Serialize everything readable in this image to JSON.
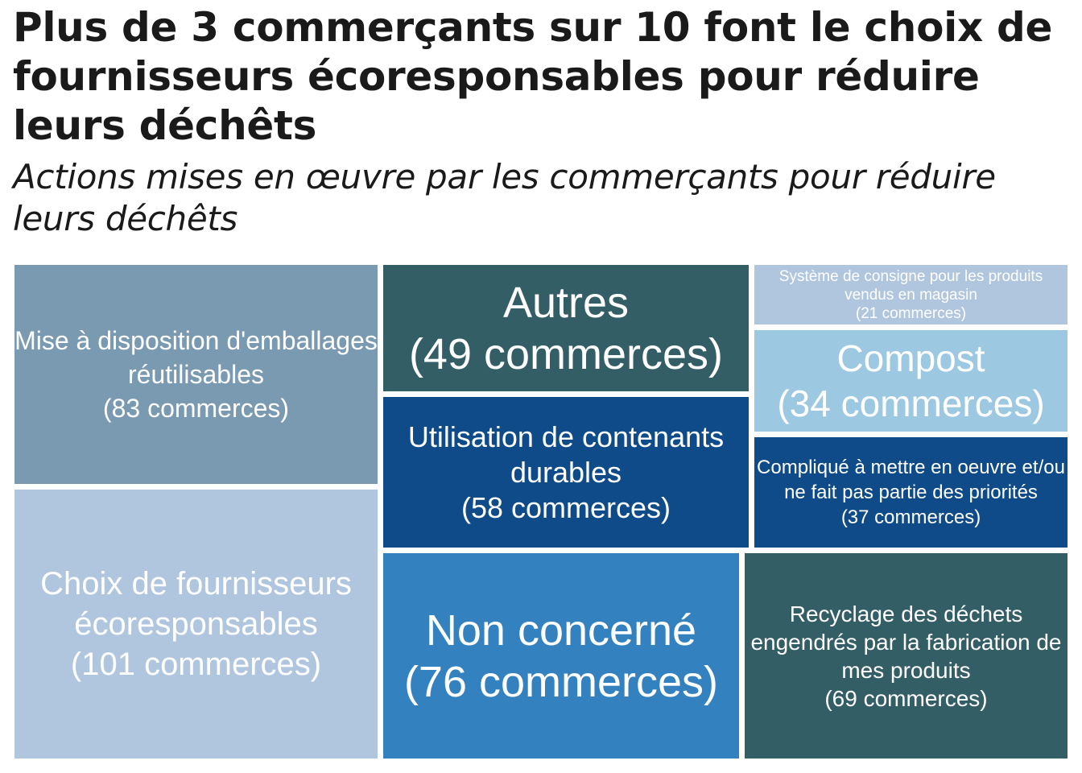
{
  "title": "Plus de 3 commerçants sur 10 font le choix de fournisseurs écoresponsables pour réduire leurs déchêts",
  "subtitle": "Actions mises en œuvre par les commerçants pour réduire leurs déchêts",
  "chart_data": {
    "type": "treemap",
    "unit": "commerces",
    "items": [
      {
        "name": "Choix de fournisseurs écoresponsables",
        "value": 101,
        "label": "(101 commerces)",
        "color": "#afc6de"
      },
      {
        "name": "Mise à disposition d'emballages réutilisables",
        "value": 83,
        "label": "(83 commerces)",
        "color": "#7a9ab2"
      },
      {
        "name": "Non concerné",
        "value": 76,
        "label": "(76 commerces)",
        "color": "#3382bf"
      },
      {
        "name": "Recyclage des déchets engendrés par la fabrication de mes produits",
        "value": 69,
        "label": "(69 commerces)",
        "color": "#335e66"
      },
      {
        "name": "Utilisation de contenants durables",
        "value": 58,
        "label": "(58 commerces)",
        "color": "#0e4b88"
      },
      {
        "name": "Autres",
        "value": 49,
        "label": "(49 commerces)",
        "color": "#335e66"
      },
      {
        "name": "Compliqué à mettre en oeuvre et/ou ne fait pas partie des priorités",
        "value": 37,
        "label": "(37 commerces)",
        "color": "#0e4b88"
      },
      {
        "name": "Compost",
        "value": 34,
        "label": "(34 commerces)",
        "color": "#9dc8e2"
      },
      {
        "name": "Système de consigne pour les produits vendus en magasin",
        "value": 21,
        "label": "(21 commerces)",
        "color": "#afc6de"
      }
    ]
  }
}
